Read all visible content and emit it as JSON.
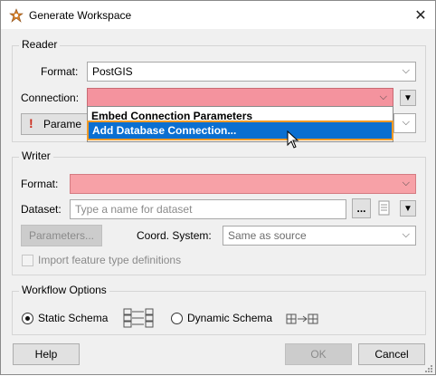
{
  "window": {
    "title": "Generate Workspace"
  },
  "reader": {
    "legend": "Reader",
    "format_label": "Format:",
    "format_value": "PostGIS",
    "connection_label": "Connection:",
    "connection_value": "",
    "parameters_label": "Parame"
  },
  "connection_dropdown": {
    "items": [
      "Embed Connection Parameters",
      "Add Database Connection..."
    ],
    "highlighted": "Add Database Connection..."
  },
  "writer": {
    "legend": "Writer",
    "format_label": "Format:",
    "format_value": "",
    "dataset_label": "Dataset:",
    "dataset_placeholder": "Type a name for dataset",
    "browse_label": "...",
    "parameters_button": "Parameters...",
    "coord_label": "Coord. System:",
    "coord_value": "Same as source",
    "import_checkbox": "Import feature type definitions"
  },
  "workflow": {
    "legend": "Workflow Options",
    "static_label": "Static Schema",
    "dynamic_label": "Dynamic Schema",
    "selected": "Static Schema"
  },
  "footer": {
    "help": "Help",
    "ok": "OK",
    "cancel": "Cancel"
  },
  "colors": {
    "error_fill": "#f4939e",
    "highlight": "#0b6fd1",
    "focus_outline": "#f09a27"
  }
}
